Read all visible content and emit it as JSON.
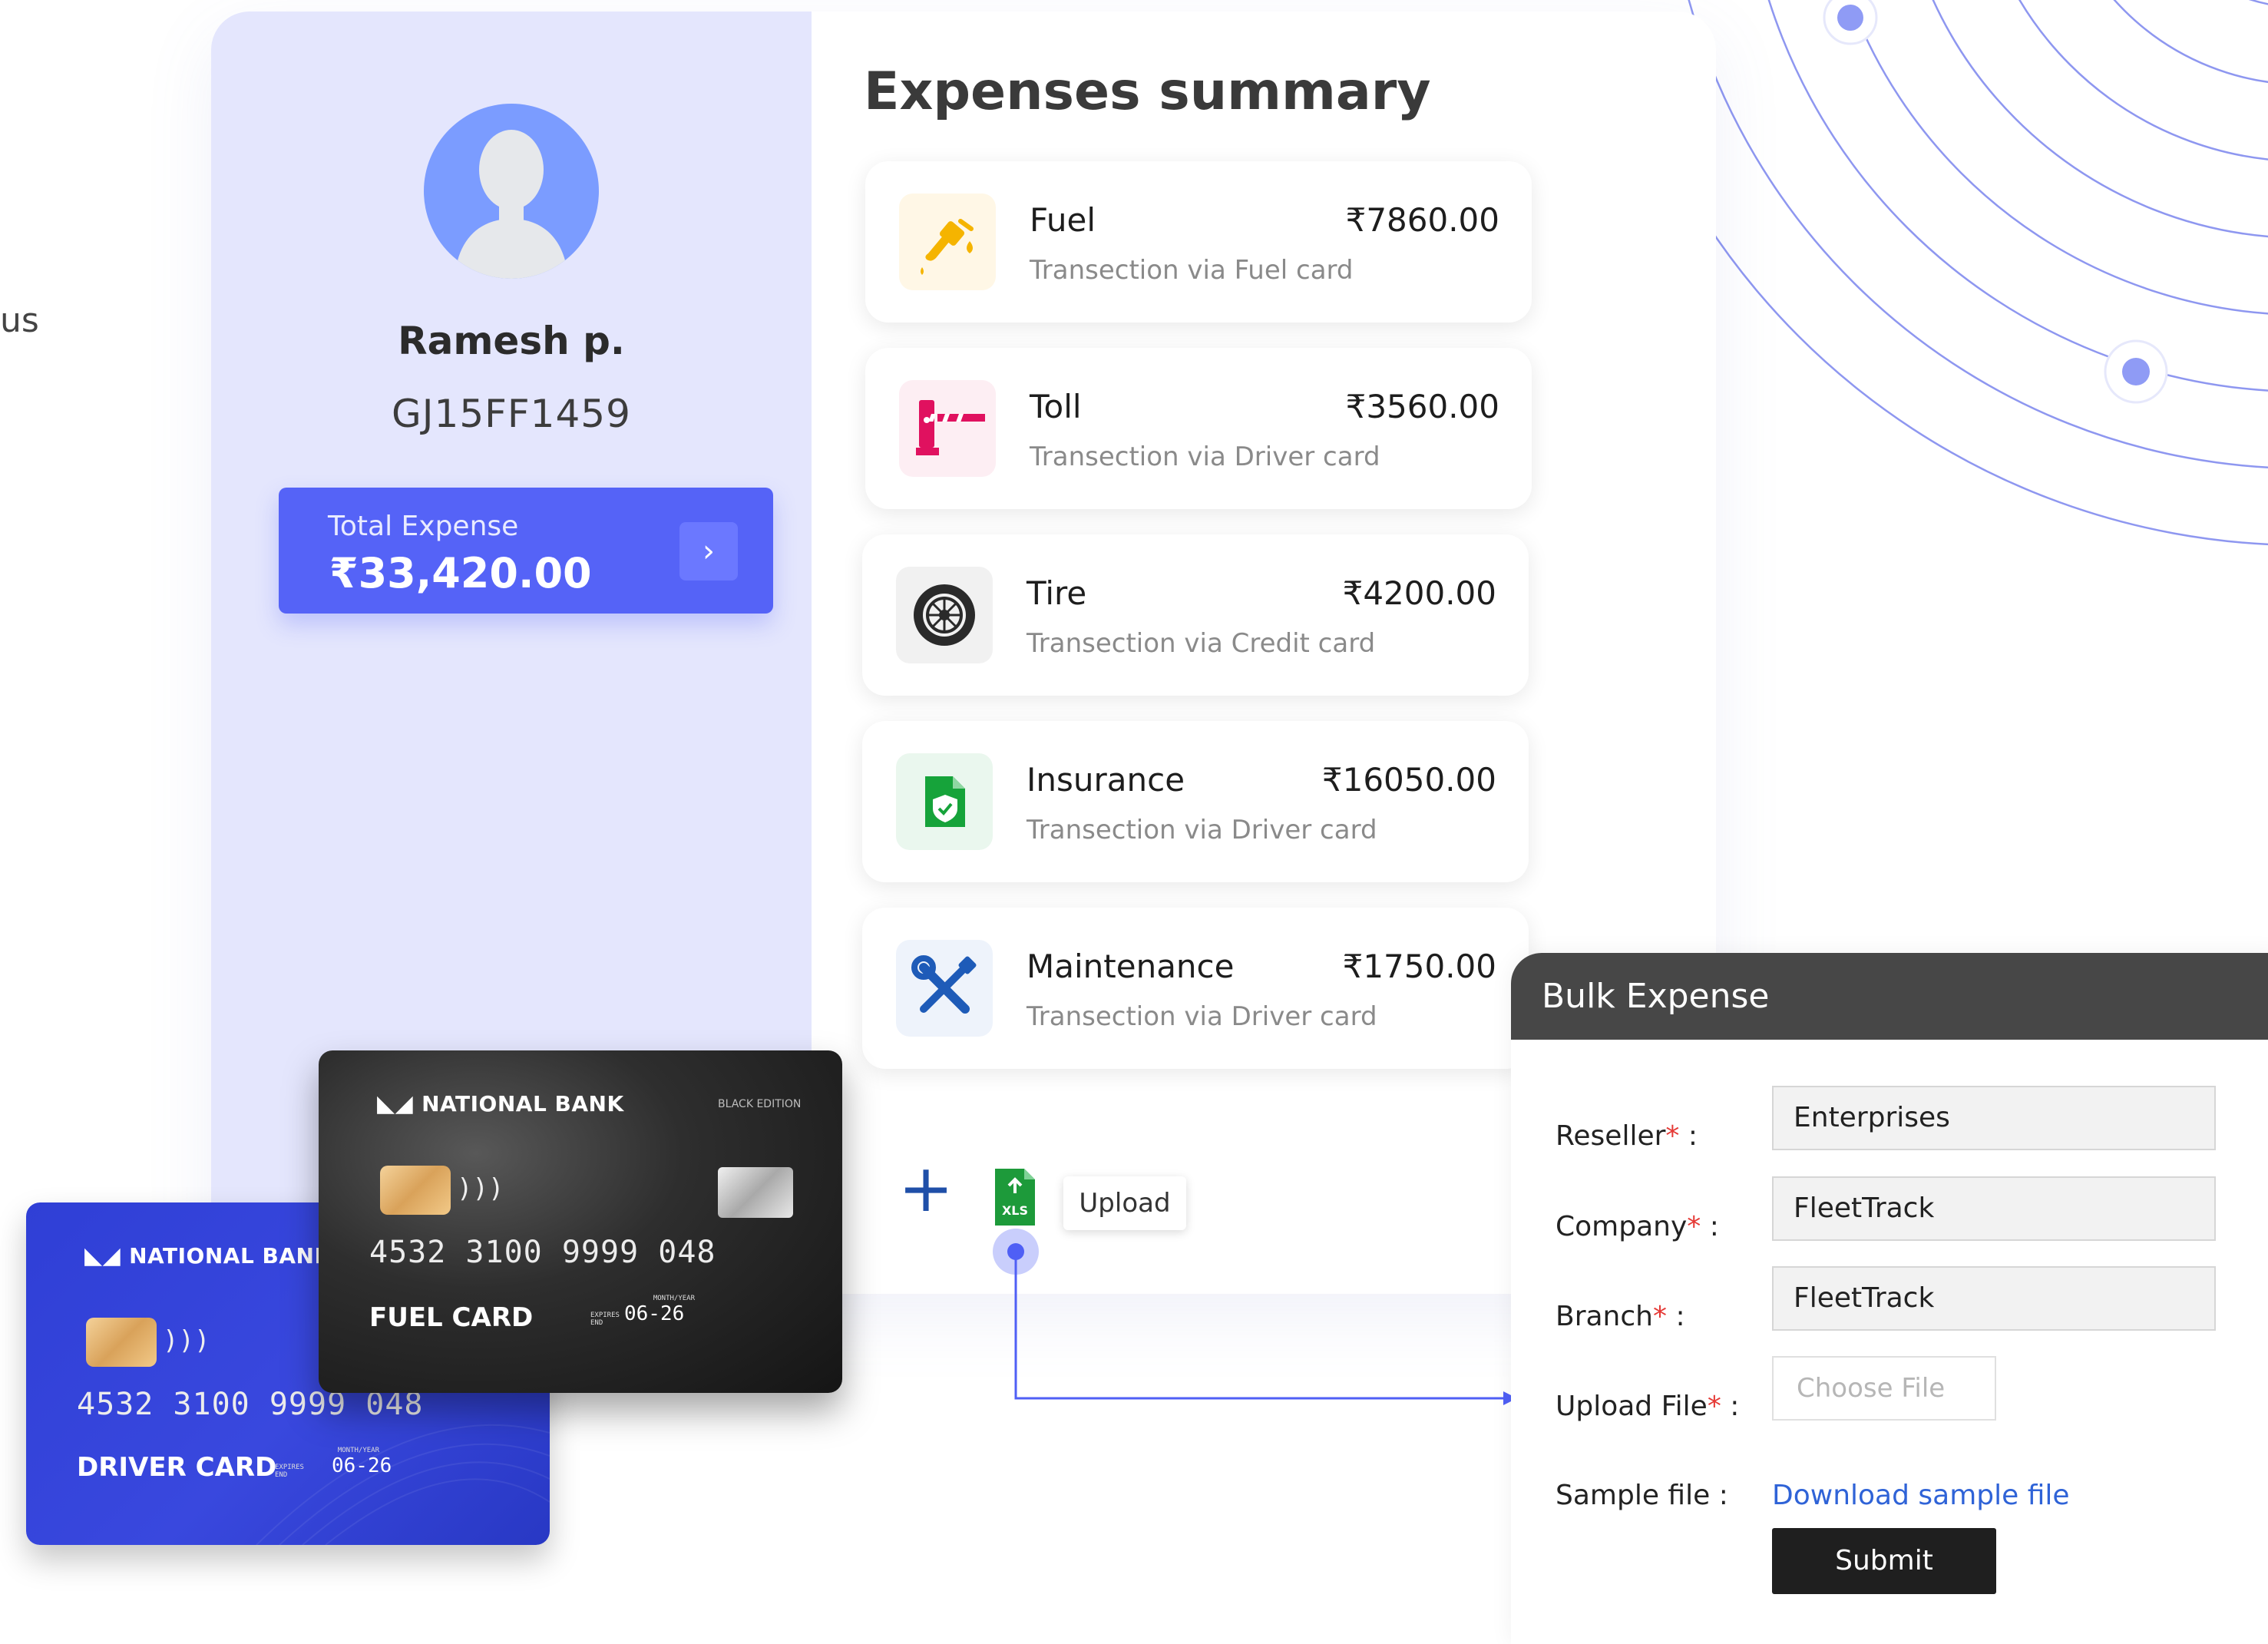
{
  "background": {
    "stray_text": "us"
  },
  "profile": {
    "name": "Ramesh p.",
    "vehicle_id": "GJ15FF1459",
    "total_label": "Total Expense",
    "total_value": "₹33,420.00",
    "arrow_icon": "chevron-right-icon"
  },
  "summary": {
    "title": "Expenses summary",
    "items": [
      {
        "name": "Fuel",
        "amount": "₹7860.00",
        "subtitle": "Transection via Fuel card",
        "icon": "fuel-pump-icon",
        "icon_bg": "#fff7e6",
        "icon_color": "#f5b400"
      },
      {
        "name": "Toll",
        "amount": "₹3560.00",
        "subtitle": "Transection via Driver card",
        "icon": "toll-gate-icon",
        "icon_bg": "#fdeef3",
        "icon_color": "#e0115f"
      },
      {
        "name": "Tire",
        "amount": "₹4200.00",
        "subtitle": "Transection via Credit card",
        "icon": "tire-icon",
        "icon_bg": "#f1f1f1",
        "icon_color": "#2a2a2a"
      },
      {
        "name": "Insurance",
        "amount": "₹16050.00",
        "subtitle": "Transection via Driver card",
        "icon": "insurance-shield-icon",
        "icon_bg": "#eaf7ee",
        "icon_color": "#16a33a"
      },
      {
        "name": "Maintenance",
        "amount": "₹1750.00",
        "subtitle": "Transection via Driver card",
        "icon": "wrench-screwdriver-icon",
        "icon_bg": "#eef3fb",
        "icon_color": "#1e5bb8"
      }
    ]
  },
  "upload": {
    "plus_icon": "plus-icon",
    "file_icon": "xls-file-icon",
    "file_badge": "XLS",
    "tooltip": "Upload"
  },
  "bulk_expense": {
    "title": "Bulk Expense",
    "reseller_label": "Reseller",
    "reseller_value": "Enterprises",
    "company_label": "Company",
    "company_value": "FleetTrack",
    "branch_label": "Branch",
    "branch_value": "FleetTrack",
    "upload_label": "Upload File",
    "upload_placeholder": "Choose File",
    "sample_label": "Sample file :",
    "sample_link": "Download sample file",
    "submit": "Submit",
    "required_mark": "*",
    "colon": ":"
  },
  "cards": {
    "driver": {
      "bank": "NATIONAL BANK",
      "number": "4532 3100 9999 048",
      "type": "DRIVER CARD",
      "month_year": "MONTH/YEAR",
      "expires_end": "EXPIRES END",
      "expiry": "06-26"
    },
    "fuel": {
      "bank": "NATIONAL BANK",
      "edition": "BLACK EDITION",
      "number": "4532 3100 9999 048",
      "type": "FUEL CARD",
      "month_year": "MONTH/YEAR",
      "expires_end": "EXPIRES END",
      "expiry": "06-26"
    }
  },
  "colors": {
    "accent": "#5563f7",
    "panel": "#e4e6fd",
    "bulk_header": "#474747",
    "link": "#2f63d7",
    "required": "#e53935"
  }
}
